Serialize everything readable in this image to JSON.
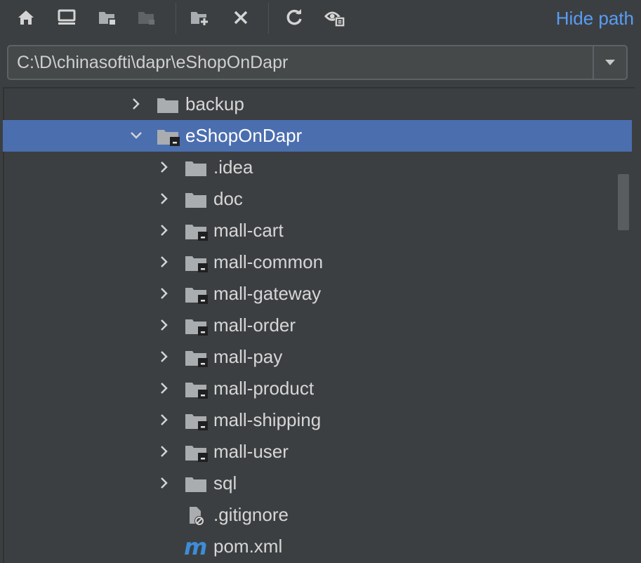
{
  "toolbar": {
    "icons": [
      "home-icon",
      "desktop-icon",
      "project-folder-icon",
      "module-folder-icon",
      "new-folder-icon",
      "delete-icon",
      "refresh-icon",
      "show-hidden-icon"
    ],
    "hide_path_label": "Hide path"
  },
  "path_field": {
    "value": "C:\\D\\chinasofti\\dapr\\eShopOnDapr"
  },
  "tree": {
    "items": [
      {
        "label": "backup",
        "level": 0,
        "expanded": false,
        "icon": "folder-icon",
        "selected": false
      },
      {
        "label": "eShopOnDapr",
        "level": 0,
        "expanded": true,
        "icon": "module-folder-icon",
        "selected": true
      },
      {
        "label": ".idea",
        "level": 1,
        "expanded": false,
        "icon": "folder-icon",
        "selected": false
      },
      {
        "label": "doc",
        "level": 1,
        "expanded": false,
        "icon": "folder-icon",
        "selected": false
      },
      {
        "label": "mall-cart",
        "level": 1,
        "expanded": false,
        "icon": "module-folder-icon",
        "selected": false
      },
      {
        "label": "mall-common",
        "level": 1,
        "expanded": false,
        "icon": "module-folder-icon",
        "selected": false
      },
      {
        "label": "mall-gateway",
        "level": 1,
        "expanded": false,
        "icon": "module-folder-icon",
        "selected": false
      },
      {
        "label": "mall-order",
        "level": 1,
        "expanded": false,
        "icon": "module-folder-icon",
        "selected": false
      },
      {
        "label": "mall-pay",
        "level": 1,
        "expanded": false,
        "icon": "module-folder-icon",
        "selected": false
      },
      {
        "label": "mall-product",
        "level": 1,
        "expanded": false,
        "icon": "module-folder-icon",
        "selected": false
      },
      {
        "label": "mall-shipping",
        "level": 1,
        "expanded": false,
        "icon": "module-folder-icon",
        "selected": false
      },
      {
        "label": "mall-user",
        "level": 1,
        "expanded": false,
        "icon": "module-folder-icon",
        "selected": false
      },
      {
        "label": "sql",
        "level": 1,
        "expanded": false,
        "icon": "folder-icon",
        "selected": false
      },
      {
        "label": ".gitignore",
        "level": 1,
        "expanded": null,
        "icon": "ignored-file-icon",
        "selected": false
      },
      {
        "label": "pom.xml",
        "level": 1,
        "expanded": null,
        "icon": "maven-file-icon",
        "selected": false
      }
    ]
  },
  "colors": {
    "background": "#3c3f41",
    "selection": "#4b6eaf",
    "link": "#589df6",
    "maven": "#3d8dd9"
  }
}
